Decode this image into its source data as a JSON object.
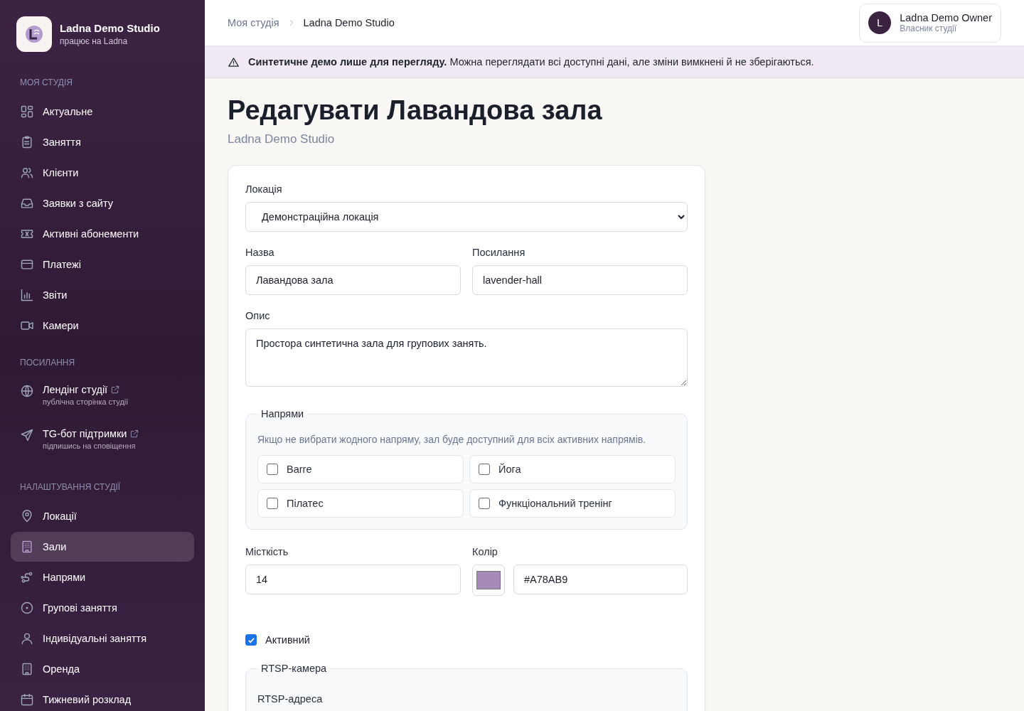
{
  "sidebar": {
    "brand": {
      "name": "Ladna Demo Studio",
      "subtitle": "працює на Ladna"
    },
    "sections": [
      {
        "title": "МОЯ СТУДІЯ",
        "items": [
          {
            "label": "Актуальне",
            "selected": false
          },
          {
            "label": "Заняття",
            "selected": false
          },
          {
            "label": "Клієнти",
            "selected": false
          },
          {
            "label": "Заявки з сайту",
            "selected": false
          },
          {
            "label": "Активні абонементи",
            "selected": false
          },
          {
            "label": "Платежі",
            "selected": false
          },
          {
            "label": "Звіти",
            "selected": false
          },
          {
            "label": "Камери",
            "selected": false
          }
        ]
      },
      {
        "title": "ПОСИЛАННЯ",
        "items": [
          {
            "label": "Лендінг студії",
            "caption": "публічна сторінка студії",
            "selected": false
          },
          {
            "label": "TG-бот підтримки",
            "caption": "підпишись на сповіщення",
            "selected": false
          }
        ]
      },
      {
        "title": "НАЛАШТУВАННЯ СТУДІЇ",
        "items": [
          {
            "label": "Локації",
            "selected": false
          },
          {
            "label": "Зали",
            "selected": true
          },
          {
            "label": "Напрями",
            "selected": false
          },
          {
            "label": "Групові заняття",
            "selected": false
          },
          {
            "label": "Індивідуальні заняття",
            "selected": false
          },
          {
            "label": "Оренда",
            "selected": false
          },
          {
            "label": "Тижневий розклад",
            "selected": false
          }
        ]
      }
    ]
  },
  "header": {
    "breadcrumb": [
      {
        "label": "Моя студія"
      },
      {
        "label": "Ladna Demo Studio"
      }
    ],
    "user": {
      "initial": "L",
      "name": "Ladna Demo Owner",
      "role": "Власник студії"
    }
  },
  "notice": "**Синтетичне демо лише для перегляду.** Можна переглядати всі доступні дані, але зміни вимкнені й не зберігаються.",
  "page": {
    "title": "Редагувати Лавандова зала",
    "subtitle": "Ladna Demo Studio"
  },
  "form": {
    "location": {
      "label": "Локація",
      "value": "Демонстраційна локація"
    },
    "name": {
      "label": "Назва",
      "value": "Лавандова зала"
    },
    "slug": {
      "label": "Посилання",
      "value": "lavender-hall"
    },
    "description": {
      "label": "Опис",
      "value": "Простора синтетична зала для групових занять."
    },
    "directions": {
      "legend": "Напрями",
      "hint": "Якщо не вибрати жодного напряму, зал буде доступний для всіх активних напрямів.",
      "options": [
        {
          "label": "Barre",
          "checked": false
        },
        {
          "label": "Йога",
          "checked": false
        },
        {
          "label": "Пілатес",
          "checked": false
        },
        {
          "label": "Функціональний тренінг",
          "checked": false
        }
      ]
    },
    "capacity": {
      "label": "Місткість",
      "value": "14"
    },
    "color": {
      "label": "Колір",
      "value": "#A78AB9"
    },
    "active": {
      "label": "Активний",
      "checked": true
    },
    "rtsp": {
      "legend": "RTSP-камера",
      "field_label": "RTSP-адреса"
    }
  }
}
